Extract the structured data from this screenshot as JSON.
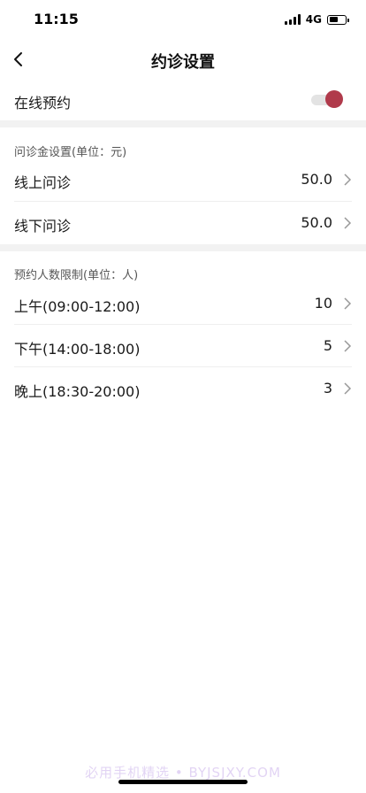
{
  "status": {
    "time": "11:15",
    "network": "4G"
  },
  "header": {
    "title": "约诊设置"
  },
  "online": {
    "label": "在线预约",
    "enabled": true
  },
  "fees": {
    "header": "问诊金设置(单位：元)",
    "items": [
      {
        "label": "线上问诊",
        "value": "50.0"
      },
      {
        "label": "线下问诊",
        "value": "50.0"
      }
    ]
  },
  "limits": {
    "header": "预约人数限制(单位：人)",
    "items": [
      {
        "label": "上午(09:00-12:00)",
        "value": "10"
      },
      {
        "label": "下午(14:00-18:00)",
        "value": "5"
      },
      {
        "label": "晚上(18:30-20:00)",
        "value": "3"
      }
    ]
  },
  "watermark": "必用手机精选 • BYJSJXY.COM",
  "colors": {
    "accent": "#b03a4b",
    "section_gap": "#f2f2f2"
  }
}
